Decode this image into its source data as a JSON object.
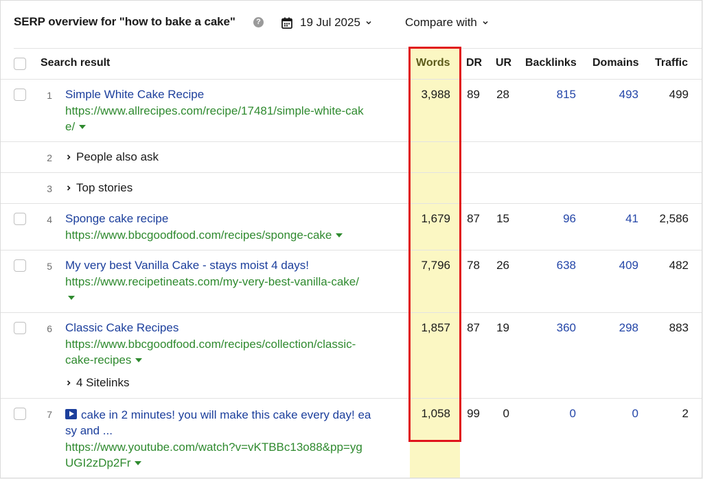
{
  "header": {
    "title": "SERP overview for \"how to bake a cake\"",
    "date": "19 Jul 2025",
    "compare_label": "Compare with"
  },
  "table": {
    "columns": {
      "search_result": "Search result",
      "words": "Words",
      "dr": "DR",
      "ur": "UR",
      "backlinks": "Backlinks",
      "domains": "Domains",
      "traffic": "Traffic"
    },
    "rows": [
      {
        "rank": "1",
        "title": "Simple White Cake Recipe",
        "url_line1": "https://www.allrecipes.com/recipe/17481/simple-white-cak",
        "url_line2": "e/",
        "words": "3,988",
        "dr": "89",
        "ur": "28",
        "backlinks": "815",
        "domains": "493",
        "traffic": "499"
      },
      {
        "rank": "2",
        "label": "People also ask"
      },
      {
        "rank": "3",
        "label": "Top stories"
      },
      {
        "rank": "4",
        "title": "Sponge cake recipe",
        "url_line1": "https://www.bbcgoodfood.com/recipes/sponge-cake",
        "words": "1,679",
        "dr": "87",
        "ur": "15",
        "backlinks": "96",
        "domains": "41",
        "traffic": "2,586"
      },
      {
        "rank": "5",
        "title": "My very best Vanilla Cake - stays moist 4 days!",
        "url_line1": "https://www.recipetineats.com/my-very-best-vanilla-cake/",
        "words": "7,796",
        "dr": "78",
        "ur": "26",
        "backlinks": "638",
        "domains": "409",
        "traffic": "482"
      },
      {
        "rank": "6",
        "title": "Classic Cake Recipes",
        "url_line1": "https://www.bbcgoodfood.com/recipes/collection/classic-",
        "url_line2": "cake-recipes",
        "sitelinks": "4 Sitelinks",
        "words": "1,857",
        "dr": "87",
        "ur": "19",
        "backlinks": "360",
        "domains": "298",
        "traffic": "883"
      },
      {
        "rank": "7",
        "title_line1": "cake in 2 minutes! you will make this cake every day! ea",
        "title_line2": "sy and ...",
        "url_line1": "https://www.youtube.com/watch?v=vKTBBc13o88&pp=yg",
        "url_line2": "UGI2zDp2Fr",
        "words": "1,058",
        "dr": "99",
        "ur": "0",
        "backlinks": "0",
        "domains": "0",
        "traffic": "2"
      }
    ]
  },
  "colors": {
    "link_title": "#1c3f9c",
    "url_green": "#2f8a2f",
    "highlight_fill": "#fbf7c3",
    "highlight_border": "#e0141b"
  }
}
